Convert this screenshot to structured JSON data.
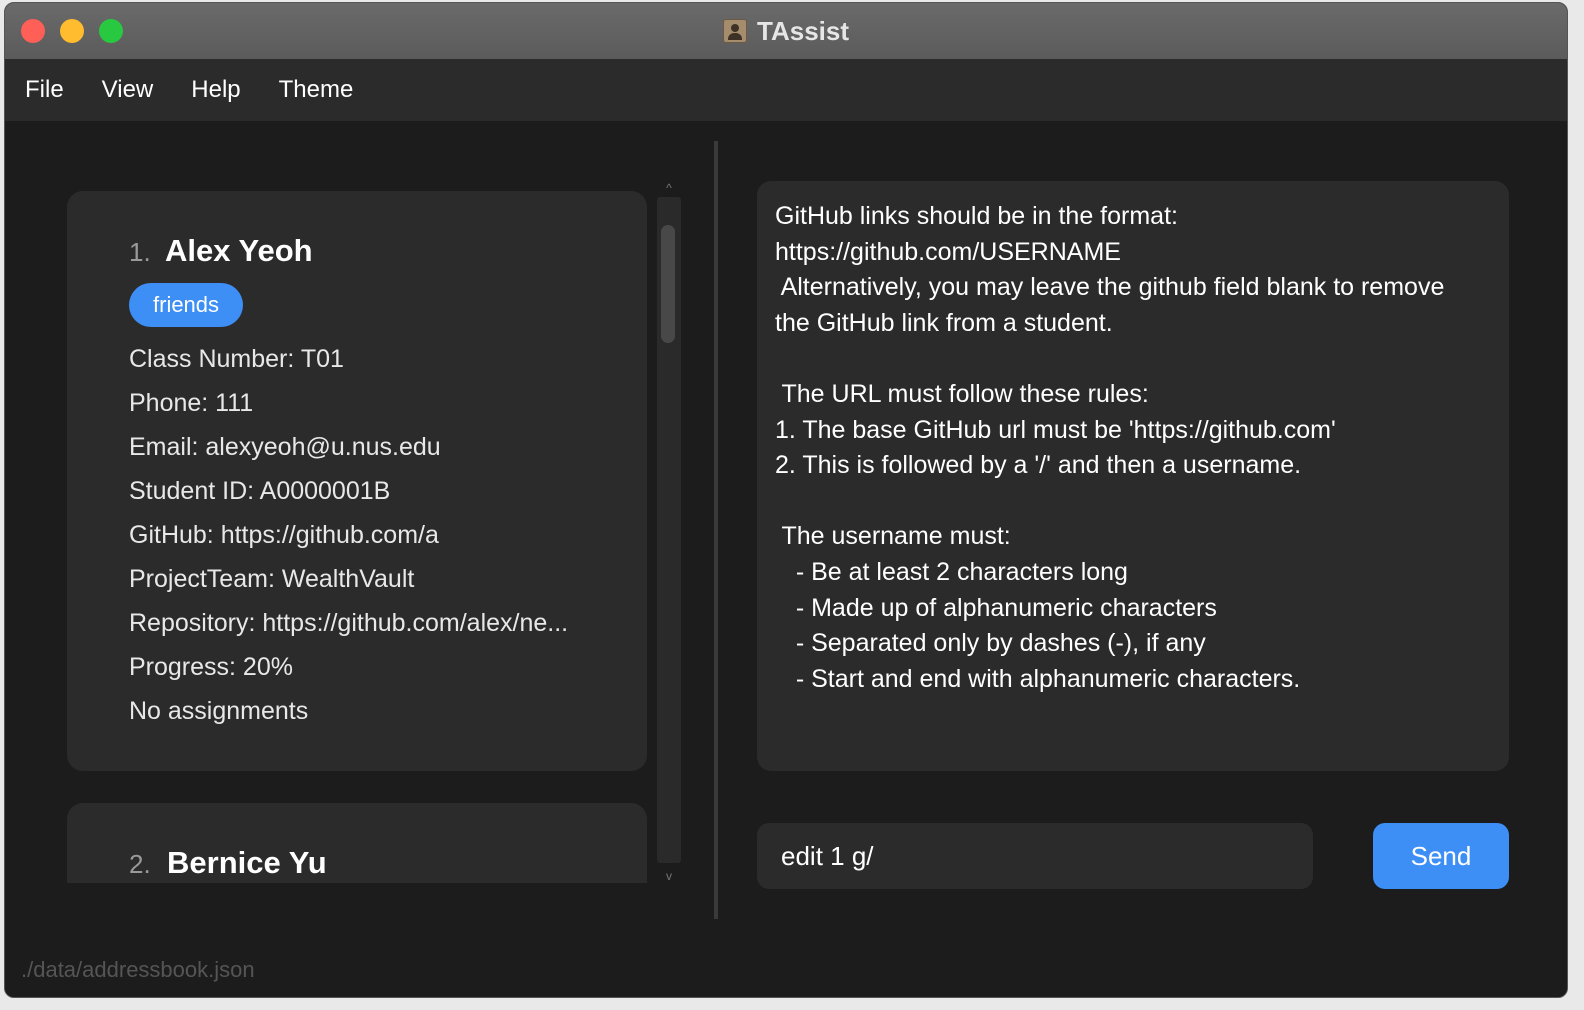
{
  "window": {
    "title": "TAssist",
    "app_icon": "address-book-icon"
  },
  "menu": {
    "items": [
      "File",
      "View",
      "Help",
      "Theme"
    ]
  },
  "students": [
    {
      "index": "1.",
      "name": "Alex Yeoh",
      "tag": "friends",
      "fields": [
        "Class Number: T01",
        "Phone: 111",
        "Email: alexyeoh@u.nus.edu",
        "Student ID: A0000001B",
        "GitHub: https://github.com/a",
        "ProjectTeam: WealthVault",
        "Repository: https://github.com/alex/ne...",
        "Progress: 20%",
        "No assignments"
      ]
    },
    {
      "index": "2.",
      "name": "Bernice Yu"
    }
  ],
  "scrollbar": {
    "up": "^",
    "down": "v"
  },
  "result": {
    "text": "GitHub links should be in the format:\nhttps://github.com/USERNAME\n Alternatively, you may leave the github field blank to remove\nthe GitHub link from a student.\n\n The URL must follow these rules:\n1. The base GitHub url must be 'https://github.com'\n2. This is followed by a '/' and then a username.\n\n The username must:\n   - Be at least 2 characters long\n   - Made up of alphanumeric characters\n   - Separated only by dashes (-), if any\n   - Start and end with alphanumeric characters."
  },
  "command": {
    "value": "edit 1 g/",
    "send_label": "Send"
  },
  "status": {
    "path": "./data/addressbook.json"
  },
  "colors": {
    "accent": "#3e8ff5",
    "card": "#2b2b2b",
    "background": "#1c1c1c"
  }
}
